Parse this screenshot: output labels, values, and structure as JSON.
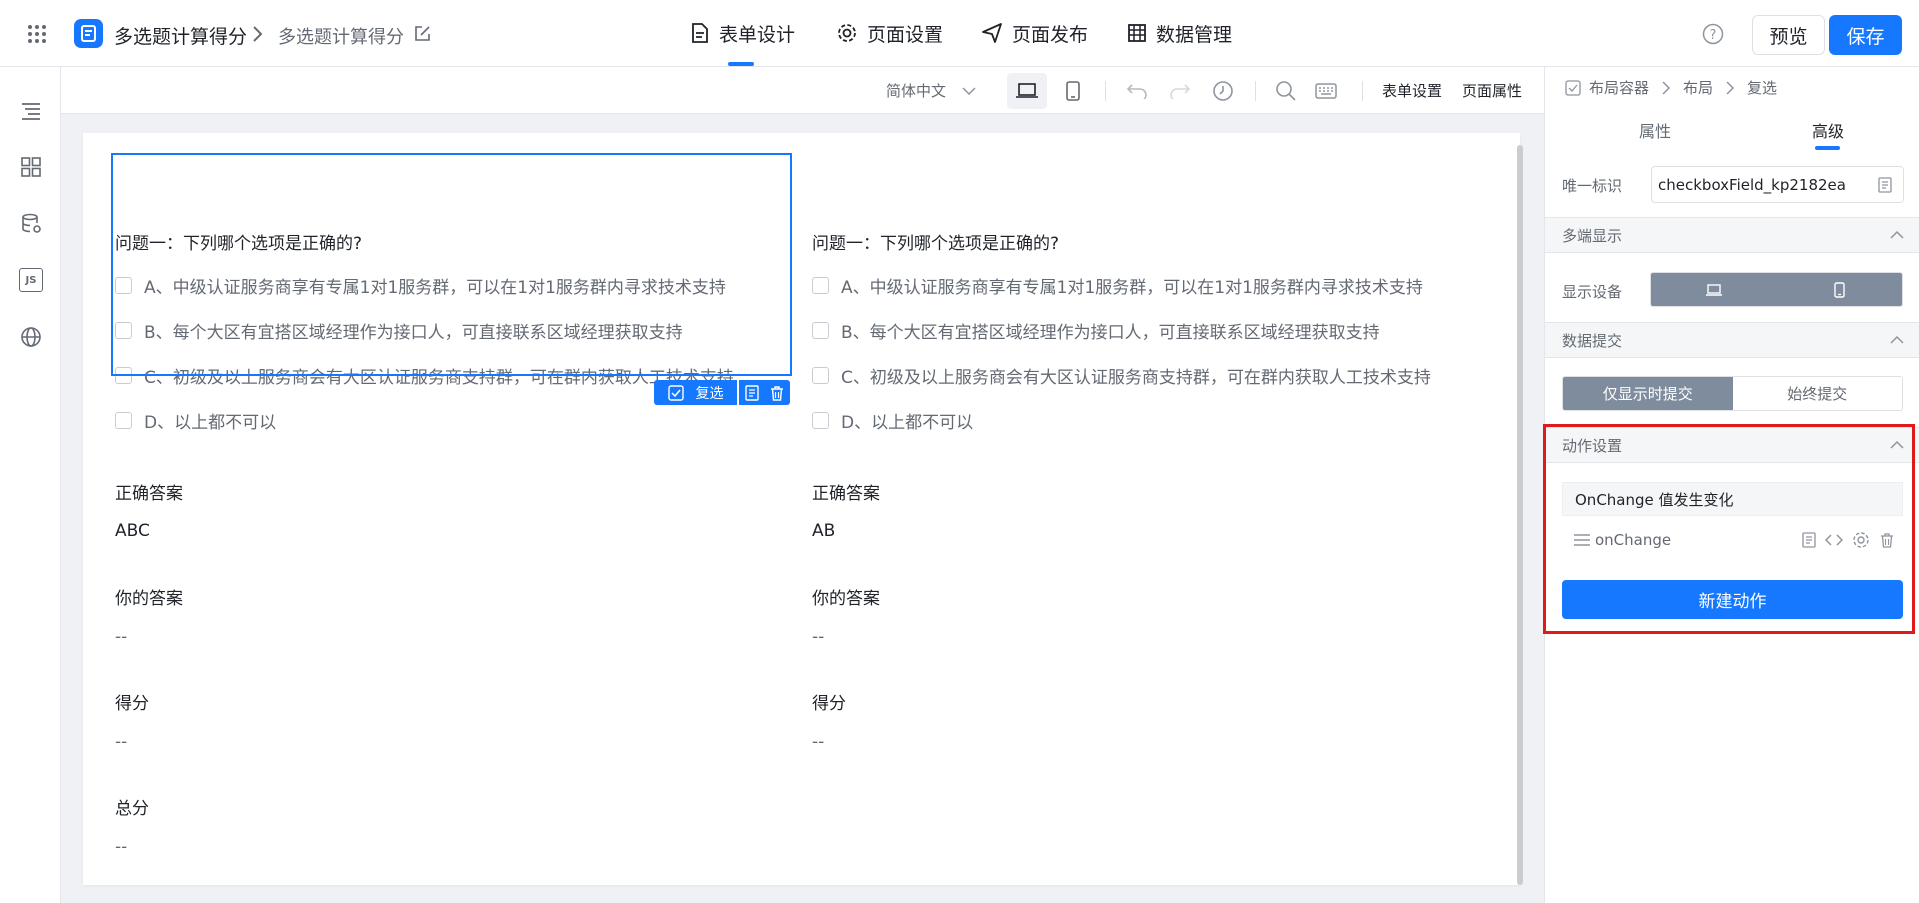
{
  "header": {
    "app_name": "多选题计算得分",
    "page_name": "多选题计算得分",
    "tabs": [
      {
        "label": "表单设计",
        "active": true
      },
      {
        "label": "页面设置"
      },
      {
        "label": "页面发布"
      },
      {
        "label": "数据管理"
      }
    ],
    "preview_label": "预览",
    "save_label": "保存"
  },
  "left_sidebar": {
    "icons": [
      "outline-icon",
      "components-icon",
      "datasource-icon",
      "js-icon",
      "globe-icon"
    ],
    "js_text": "JS"
  },
  "toolbar": {
    "language": "简体中文",
    "form_settings": "表单设置",
    "page_properties": "页面属性"
  },
  "form": {
    "columns": [
      {
        "question": "问题一：下列哪个选项是正确的?",
        "options": [
          "A、中级认证服务商享有专属1对1服务群，可以在1对1服务群内寻求技术支持",
          "B、每个大区有宜搭区域经理作为接口人，可直接联系区域经理获取支持",
          "C、初级及以上服务商会有大区认证服务商支持群，可在群内获取人工技术支持",
          "D、以上都不可以"
        ],
        "correct_label": "正确答案",
        "correct_value": "ABC",
        "your_label": "你的答案",
        "your_value": "--",
        "score_label": "得分",
        "score_value": "--",
        "total_label": "总分",
        "total_value": "--"
      },
      {
        "question": "问题一：下列哪个选项是正确的?",
        "options": [
          "A、中级认证服务商享有专属1对1服务群，可以在1对1服务群内寻求技术支持",
          "B、每个大区有宜搭区域经理作为接口人，可直接联系区域经理获取支持",
          "C、初级及以上服务商会有大区认证服务商支持群，可在群内获取人工技术支持",
          "D、以上都不可以"
        ],
        "correct_label": "正确答案",
        "correct_value": "AB",
        "your_label": "你的答案",
        "your_value": "--",
        "score_label": "得分",
        "score_value": "--"
      }
    ],
    "selected_tag": "复选"
  },
  "right_panel": {
    "breadcrumb": [
      "布局容器",
      "布局",
      "复选"
    ],
    "tabs": [
      {
        "label": "属性"
      },
      {
        "label": "高级",
        "active": true
      }
    ],
    "unique_id_label": "唯一标识",
    "unique_id_value": "checkboxField_kp2182ea",
    "multi_display_title": "多端显示",
    "display_device_label": "显示设备",
    "data_submit_title": "数据提交",
    "submit_options": [
      "仅显示时提交",
      "始终提交"
    ],
    "action_settings_title": "动作设置",
    "action_event": "OnChange 值发生变化",
    "action_name": "onChange",
    "new_action_label": "新建动作"
  },
  "colors": {
    "primary": "#1678ff",
    "highlight_border": "#e0191a",
    "segment_active": "#7f8c9d"
  }
}
